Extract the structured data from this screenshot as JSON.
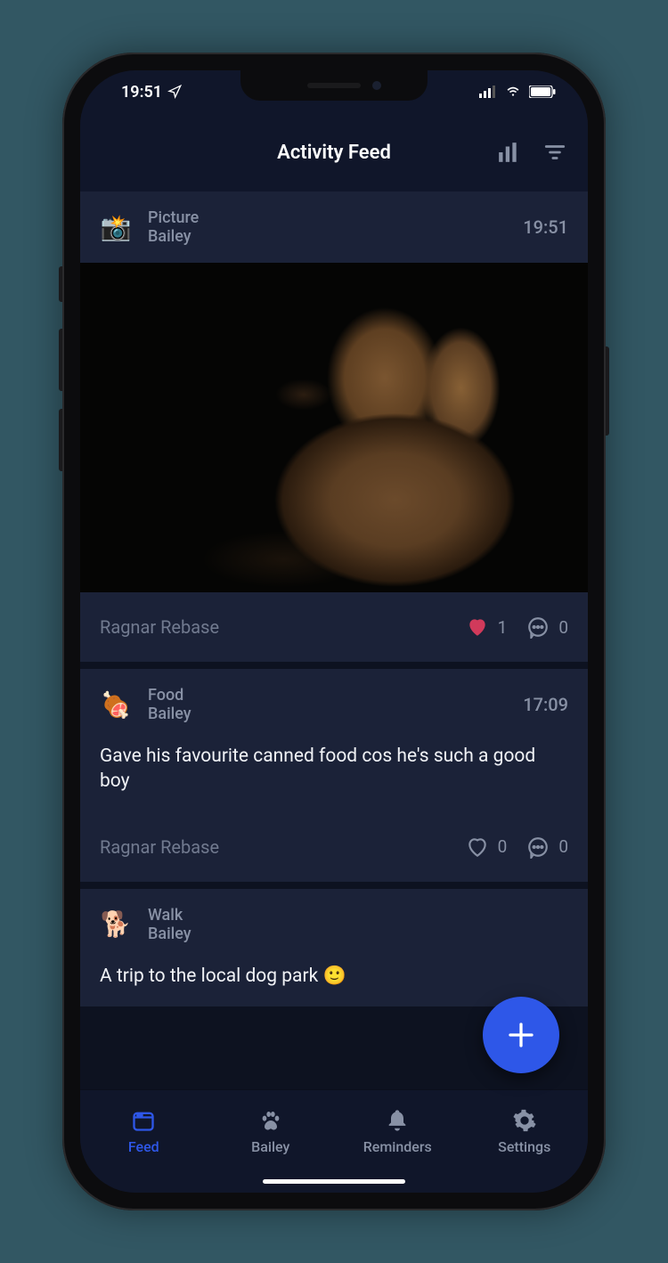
{
  "status": {
    "time": "19:51"
  },
  "header": {
    "title": "Activity Feed"
  },
  "posts": [
    {
      "icon": "📸",
      "type": "Picture",
      "pet": "Bailey",
      "time": "19:51",
      "author": "Ragnar Rebase",
      "likes": "1",
      "liked": true,
      "comments": "0",
      "body": null,
      "photo": true
    },
    {
      "icon": "🍖",
      "type": "Food",
      "pet": "Bailey",
      "time": "17:09",
      "author": "Ragnar Rebase",
      "likes": "0",
      "liked": false,
      "comments": "0",
      "body": "Gave his favourite canned food cos he's such a good boy",
      "photo": false
    },
    {
      "icon": "🐕",
      "type": "Walk",
      "pet": "Bailey",
      "time": "",
      "body": "A trip to the local dog park 🙂",
      "photo": false
    }
  ],
  "tabs": [
    {
      "label": "Feed",
      "active": true
    },
    {
      "label": "Bailey",
      "active": false
    },
    {
      "label": "Reminders",
      "active": false
    },
    {
      "label": "Settings",
      "active": false
    }
  ]
}
